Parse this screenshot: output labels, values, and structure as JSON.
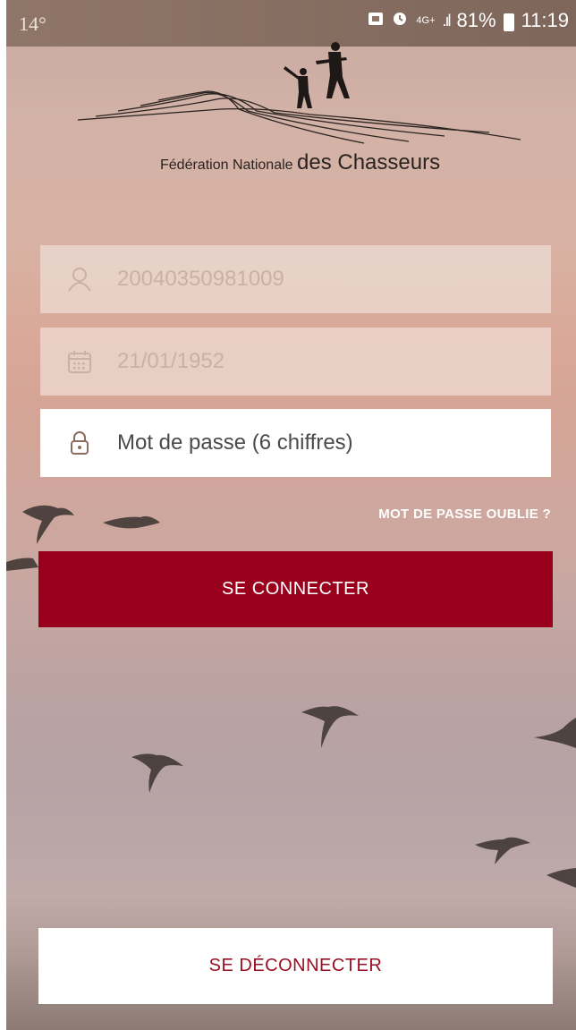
{
  "status_bar": {
    "temperature": "14°",
    "network": "4G+",
    "battery": "81%",
    "time": "11:19"
  },
  "logo": {
    "text_small": "Fédération Nationale",
    "text_big": "des Chasseurs"
  },
  "form": {
    "id_value": "20040350981009",
    "birthdate_value": "21/01/1952",
    "password_placeholder": "Mot de passe (6 chiffres)",
    "forgot_link": "MOT DE PASSE OUBLIE ?",
    "connect_label": "SE CONNECTER",
    "disconnect_label": "SE DÉCONNECTER"
  },
  "icons": {
    "id": "person-icon",
    "birthdate": "calendar-icon",
    "password": "lock-icon"
  },
  "colors": {
    "primary": "#98001c",
    "status_bar": "#8f7668"
  }
}
